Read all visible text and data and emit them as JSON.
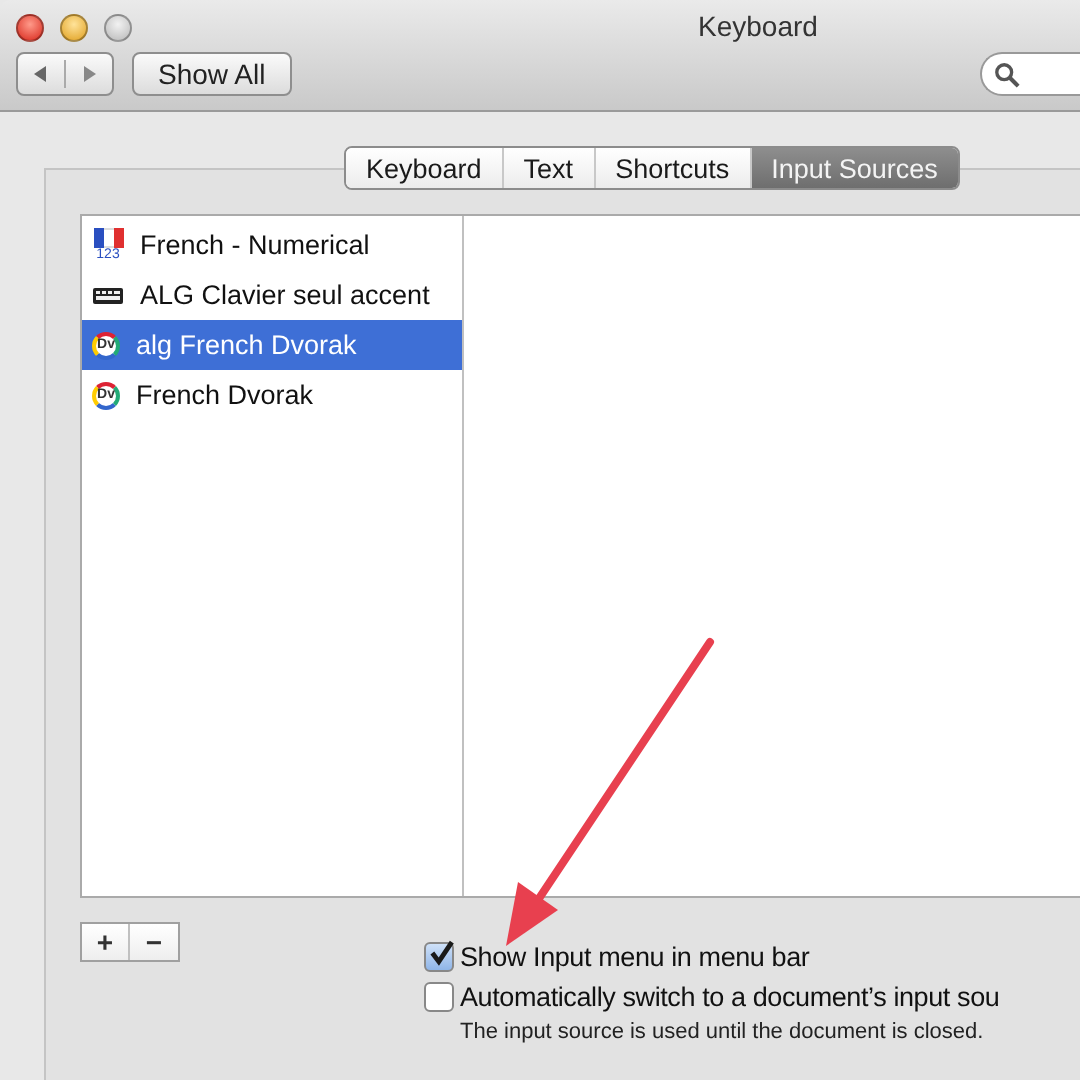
{
  "window": {
    "title": "Keyboard"
  },
  "toolbar": {
    "show_all": "Show All"
  },
  "tabs": [
    {
      "label": "Keyboard",
      "selected": false
    },
    {
      "label": "Text",
      "selected": false
    },
    {
      "label": "Shortcuts",
      "selected": false
    },
    {
      "label": "Input Sources",
      "selected": true
    }
  ],
  "input_sources": [
    {
      "name": "French - Numerical",
      "kind": "flag",
      "icon_text": "123",
      "selected": false
    },
    {
      "name": "ALG Clavier seul accent",
      "kind": "keyboard",
      "selected": false
    },
    {
      "name": "alg French Dvorak",
      "kind": "dvorak",
      "icon_text": "Dv",
      "selected": true
    },
    {
      "name": "French Dvorak",
      "kind": "dvorak",
      "icon_text": "Dv",
      "selected": false
    }
  ],
  "list_buttons": [
    "+",
    "−"
  ],
  "options": [
    {
      "label": "Show Input menu in menu bar",
      "checked": true
    },
    {
      "label": "Automatically switch to a document’s input sou",
      "checked": false
    }
  ],
  "note": "The input source is used until the document is closed."
}
